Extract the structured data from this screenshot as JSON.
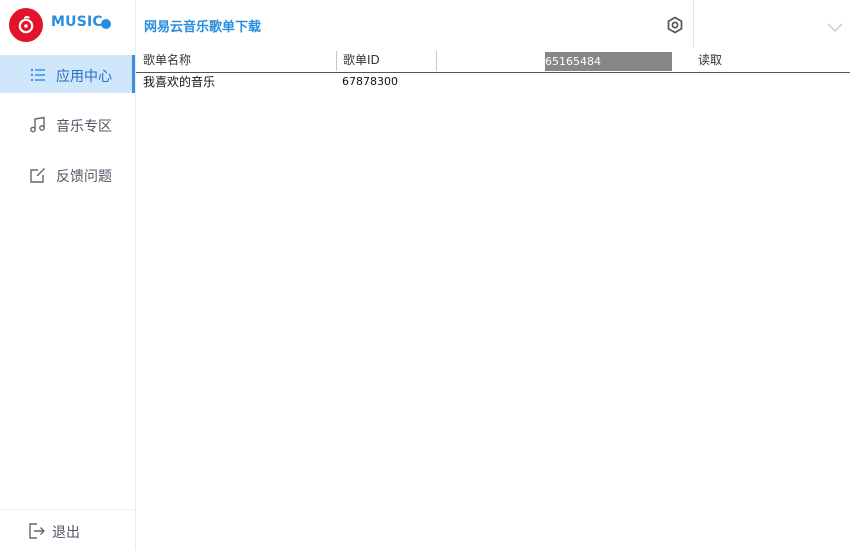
{
  "brand": {
    "logo_text": "MUSIC",
    "accent": "#2a8ee0",
    "logo_color": "#e0152b"
  },
  "app_title": "网易云音乐歌单下载",
  "sidebar": {
    "items": [
      {
        "label": "应用中心",
        "icon": "list-icon",
        "active": true
      },
      {
        "label": "音乐专区",
        "icon": "music-note-icon",
        "active": false
      },
      {
        "label": "反馈问题",
        "icon": "edit-icon",
        "active": false
      }
    ],
    "logout": {
      "label": "退出",
      "icon": "logout-icon"
    }
  },
  "toolbar": {
    "settings_icon": "gear-icon",
    "collapse_icon": "chevron-down-icon"
  },
  "table": {
    "columns": [
      "歌单名称",
      "歌单ID"
    ],
    "id_input_value": "65165484",
    "read_button": "读取",
    "rows": [
      {
        "name": "我喜欢的音乐",
        "id": "67878300"
      }
    ]
  }
}
